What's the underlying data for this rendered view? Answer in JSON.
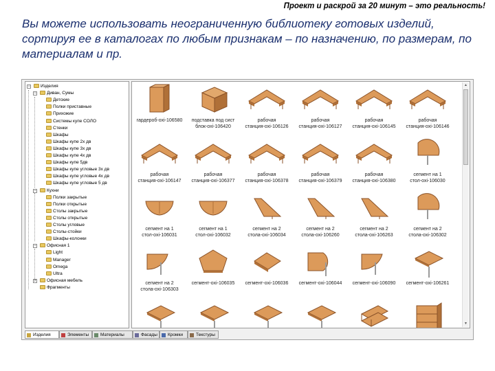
{
  "header_note": "Проект и раскрой за 20 минут – это реальность!",
  "intro": "Вы можете использовать неограниченную библиотеку готовых изделий, сортируя ее в каталогах по любым признакам – по назначению, по размерам, по материалам и пр.",
  "tree": [
    {
      "label": "Изделия",
      "level": 0,
      "expander": "minus"
    },
    {
      "label": "Диван, Сумы",
      "level": 1,
      "expander": "minus"
    },
    {
      "label": "Детские",
      "level": 2
    },
    {
      "label": "Полки приставные",
      "level": 2
    },
    {
      "label": "Прихожие",
      "level": 2
    },
    {
      "label": "Системы купе СОЛО",
      "level": 2
    },
    {
      "label": "Стенки",
      "level": 2
    },
    {
      "label": "Шкафы",
      "level": 2
    },
    {
      "label": "Шкафы купе 2х дв",
      "level": 2
    },
    {
      "label": "Шкафы купе 3х дв",
      "level": 2
    },
    {
      "label": "Шкафы купе 4х дв",
      "level": 2
    },
    {
      "label": "Шкафы купе 5дв",
      "level": 2
    },
    {
      "label": "Шкафы купе угловые 3х дв",
      "level": 2
    },
    {
      "label": "Шкафы купе угловые 4х дв",
      "level": 2
    },
    {
      "label": "Шкафы купе угловые 5 дв",
      "level": 2
    },
    {
      "label": "Кухни",
      "level": 1,
      "expander": "minus"
    },
    {
      "label": "Полки закрытые",
      "level": 2
    },
    {
      "label": "Полки открытые",
      "level": 2
    },
    {
      "label": "Столы закрытые",
      "level": 2
    },
    {
      "label": "Столы открытые",
      "level": 2
    },
    {
      "label": "Столы угловые",
      "level": 2
    },
    {
      "label": "Столы-стойки",
      "level": 2
    },
    {
      "label": "Шкафы-колонки",
      "level": 2
    },
    {
      "label": "Офисная 1",
      "level": 1,
      "expander": "minus"
    },
    {
      "label": "Light",
      "level": 2
    },
    {
      "label": "Manager",
      "level": 2
    },
    {
      "label": "Omega",
      "level": 2
    },
    {
      "label": "Ultra",
      "level": 2
    },
    {
      "label": "Офисная мебель",
      "level": 1,
      "expander": "plus"
    },
    {
      "label": "Фрагменты",
      "level": 1
    }
  ],
  "items": [
    {
      "caption": [
        "гардероб-oxi-106580"
      ],
      "shape": "wardrobe"
    },
    {
      "caption": [
        "подставка под сист",
        "блок-oxi-106420"
      ],
      "shape": "box"
    },
    {
      "caption": [
        "рабочая",
        "станция-oxi-106126"
      ],
      "shape": "corner-desk"
    },
    {
      "caption": [
        "рабочая",
        "станция-oxi-106127"
      ],
      "shape": "corner-desk"
    },
    {
      "caption": [
        "рабочая",
        "станция-oxi-106145"
      ],
      "shape": "corner-desk"
    },
    {
      "caption": [
        "рабочая",
        "станция-oxi-106146"
      ],
      "shape": "corner-desk"
    },
    {
      "caption": [
        "рабочая",
        "станция-oxi-106147"
      ],
      "shape": "corner-desk"
    },
    {
      "caption": [
        "рабочая",
        "станция-oxi-106377"
      ],
      "shape": "corner-desk"
    },
    {
      "caption": [
        "рабочая",
        "станция-oxi-106378"
      ],
      "shape": "corner-desk"
    },
    {
      "caption": [
        "рабочая",
        "станция-oxi-106379"
      ],
      "shape": "corner-desk"
    },
    {
      "caption": [
        "рабочая",
        "станция-oxi-106380"
      ],
      "shape": "corner-desk"
    },
    {
      "caption": [
        "сегмент на 1",
        "стол-oxi-106030"
      ],
      "shape": "half-round"
    },
    {
      "caption": [
        "сегмент на 1",
        "стол-oxi-106031"
      ],
      "shape": "fan"
    },
    {
      "caption": [
        "сегмент на 1",
        "стол-oxi-106032"
      ],
      "shape": "fan"
    },
    {
      "caption": [
        "сегмент на 2",
        "стола-oxi-106034"
      ],
      "shape": "wedge"
    },
    {
      "caption": [
        "сегмент на 2",
        "стола-oxi-106260"
      ],
      "shape": "wedge"
    },
    {
      "caption": [
        "сегмент на 2",
        "стола-oxi-106263"
      ],
      "shape": "wedge"
    },
    {
      "caption": [
        "сегмент на 2",
        "стола-oxi-106302"
      ],
      "shape": "half-round"
    },
    {
      "caption": [
        "сегмент на 2",
        "стола-oxi-106303"
      ],
      "shape": "quarter-leg"
    },
    {
      "caption": [
        "сегмент-oxi-106035"
      ],
      "shape": "pentagon"
    },
    {
      "caption": [
        "сегмент-oxi-106036"
      ],
      "shape": "square-flat"
    },
    {
      "caption": [
        "сегмент-oxi-106044"
      ],
      "shape": "round-leg"
    },
    {
      "caption": [
        "сегмент-oxi-106090"
      ],
      "shape": "quarter-leg"
    },
    {
      "caption": [
        "сегмент-oxi-106261"
      ],
      "shape": "square-leg"
    },
    {
      "caption": [],
      "shape": "square-leg"
    },
    {
      "caption": [],
      "shape": "square-leg"
    },
    {
      "caption": [],
      "shape": "square-leg"
    },
    {
      "caption": [],
      "shape": "square-leg"
    },
    {
      "caption": [],
      "shape": "shelf"
    },
    {
      "caption": [],
      "shape": "cabinet"
    }
  ],
  "tabs": [
    {
      "label": "Изделия",
      "icon": "folder-icon",
      "active": true
    },
    {
      "label": "Элементы",
      "icon": "pin-icon",
      "active": false
    },
    {
      "label": "Материалы",
      "icon": "grid-icon",
      "active": false
    },
    {
      "label": "Фасады",
      "icon": "facade-icon",
      "active": false
    },
    {
      "label": "Кромки",
      "icon": "edge-icon",
      "active": false
    },
    {
      "label": "Текстуры",
      "icon": "texture-icon",
      "active": false
    }
  ],
  "colors": {
    "wood": "#dc9a5a",
    "wood_dark": "#b07038",
    "wood_edge": "#8a5228",
    "intro_text": "#1a2f6e"
  }
}
